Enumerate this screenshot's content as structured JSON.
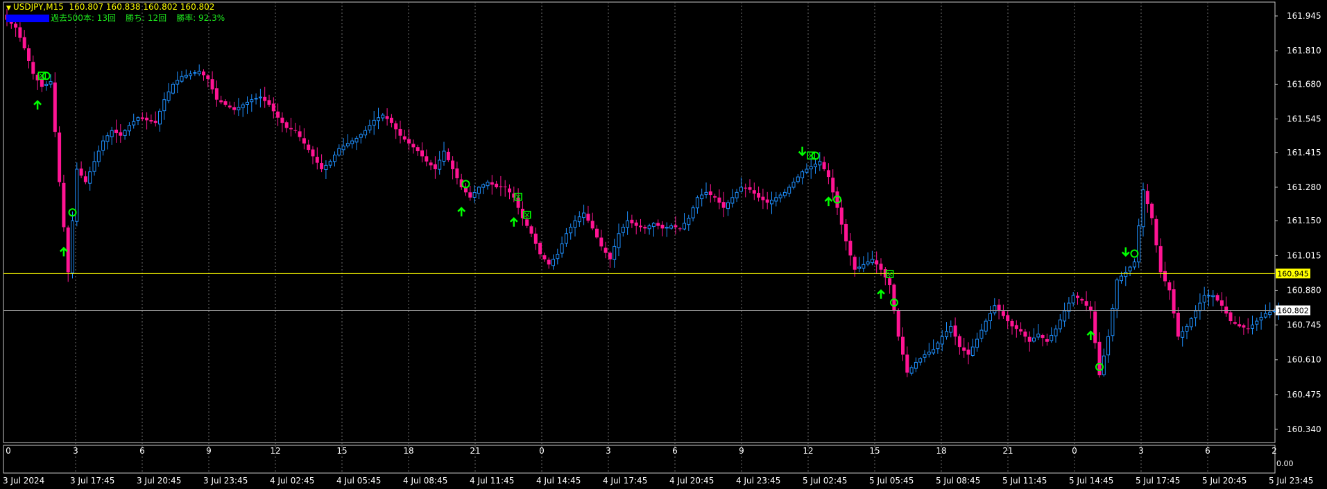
{
  "header": {
    "symbol": "USDJPY,M15",
    "ohlc": "160.807 160.838 160.802 160.802",
    "stats_past": "過去500本: 13回",
    "stats_wins": "勝ち: 12回",
    "stats_rate": "勝率: 92.3%"
  },
  "colors": {
    "background": "#000000",
    "bull": "#1e90ff",
    "bear": "#ff1493",
    "signal": "#00ff00",
    "level_line": "#ffff00",
    "bid_line": "#a0a0a0",
    "grid": "#6e6e6e"
  },
  "chart_data": {
    "type": "candlestick",
    "symbol": "USDJPY",
    "timeframe": "M15",
    "ylim": [
      160.28,
      162.0
    ],
    "y_ticks": [
      "161.945",
      "161.810",
      "161.680",
      "161.545",
      "161.415",
      "161.280",
      "161.150",
      "161.015",
      "160.880",
      "160.745",
      "160.610",
      "160.475",
      "160.340"
    ],
    "horizontal_lines": [
      {
        "label": "160.945",
        "value": 160.945,
        "color": "#ffff00"
      },
      {
        "label": "160.802",
        "value": 160.802,
        "color": "#a0a0a0"
      }
    ],
    "x_hour_labels": [
      "0",
      "3",
      "6",
      "9",
      "12",
      "15",
      "18",
      "21",
      "0",
      "3",
      "6",
      "9",
      "12",
      "15",
      "18",
      "21",
      "0",
      "3",
      "6",
      "2"
    ],
    "x_date_labels": [
      "3 Jul 2024",
      "3 Jul 17:45",
      "3 Jul 20:45",
      "3 Jul 23:45",
      "4 Jul 02:45",
      "4 Jul 05:45",
      "4 Jul 08:45",
      "4 Jul 11:45",
      "4 Jul 14:45",
      "4 Jul 17:45",
      "4 Jul 20:45",
      "4 Jul 23:45",
      "5 Jul 02:45",
      "5 Jul 05:45",
      "5 Jul 08:45",
      "5 Jul 11:45",
      "5 Jul 14:45",
      "5 Jul 17:45",
      "5 Jul 20:45",
      "5 Jul 23:45"
    ],
    "sub_panel_label": "0.00",
    "close_path": [
      [
        0,
        161.93
      ],
      [
        2,
        161.9
      ],
      [
        4,
        161.82
      ],
      [
        6,
        161.72
      ],
      [
        8,
        161.67
      ],
      [
        10,
        161.69
      ],
      [
        12,
        161.3
      ],
      [
        14,
        160.95
      ],
      [
        16,
        161.35
      ],
      [
        18,
        161.3
      ],
      [
        20,
        161.38
      ],
      [
        22,
        161.46
      ],
      [
        24,
        161.5
      ],
      [
        26,
        161.48
      ],
      [
        28,
        161.52
      ],
      [
        30,
        161.55
      ],
      [
        32,
        161.54
      ],
      [
        34,
        161.53
      ],
      [
        36,
        161.62
      ],
      [
        38,
        161.68
      ],
      [
        40,
        161.71
      ],
      [
        42,
        161.72
      ],
      [
        44,
        161.73
      ],
      [
        46,
        161.7
      ],
      [
        48,
        161.62
      ],
      [
        50,
        161.6
      ],
      [
        52,
        161.58
      ],
      [
        54,
        161.6
      ],
      [
        56,
        161.62
      ],
      [
        58,
        161.63
      ],
      [
        60,
        161.6
      ],
      [
        62,
        161.55
      ],
      [
        64,
        161.51
      ],
      [
        66,
        161.5
      ],
      [
        68,
        161.45
      ],
      [
        70,
        161.4
      ],
      [
        72,
        161.35
      ],
      [
        74,
        161.38
      ],
      [
        76,
        161.43
      ],
      [
        78,
        161.45
      ],
      [
        80,
        161.47
      ],
      [
        82,
        161.5
      ],
      [
        84,
        161.54
      ],
      [
        86,
        161.56
      ],
      [
        88,
        161.53
      ],
      [
        90,
        161.48
      ],
      [
        92,
        161.45
      ],
      [
        94,
        161.42
      ],
      [
        96,
        161.38
      ],
      [
        98,
        161.35
      ],
      [
        100,
        161.42
      ],
      [
        102,
        161.35
      ],
      [
        104,
        161.28
      ],
      [
        106,
        161.24
      ],
      [
        108,
        161.28
      ],
      [
        110,
        161.3
      ],
      [
        112,
        161.28
      ],
      [
        114,
        161.28
      ],
      [
        116,
        161.24
      ],
      [
        118,
        161.16
      ],
      [
        120,
        161.1
      ],
      [
        122,
        161.02
      ],
      [
        124,
        160.98
      ],
      [
        126,
        161.02
      ],
      [
        128,
        161.1
      ],
      [
        130,
        161.15
      ],
      [
        132,
        161.18
      ],
      [
        134,
        161.12
      ],
      [
        136,
        161.05
      ],
      [
        138,
        161.0
      ],
      [
        140,
        161.1
      ],
      [
        142,
        161.15
      ],
      [
        144,
        161.13
      ],
      [
        146,
        161.12
      ],
      [
        148,
        161.14
      ],
      [
        150,
        161.12
      ],
      [
        152,
        161.13
      ],
      [
        154,
        161.12
      ],
      [
        156,
        161.16
      ],
      [
        158,
        161.24
      ],
      [
        160,
        161.26
      ],
      [
        162,
        161.24
      ],
      [
        164,
        161.2
      ],
      [
        166,
        161.24
      ],
      [
        168,
        161.28
      ],
      [
        170,
        161.27
      ],
      [
        172,
        161.24
      ],
      [
        174,
        161.22
      ],
      [
        176,
        161.24
      ],
      [
        178,
        161.26
      ],
      [
        180,
        161.3
      ],
      [
        182,
        161.34
      ],
      [
        184,
        161.36
      ],
      [
        186,
        161.38
      ],
      [
        188,
        161.32
      ],
      [
        190,
        161.2
      ],
      [
        192,
        161.07
      ],
      [
        194,
        160.96
      ],
      [
        196,
        160.98
      ],
      [
        198,
        161.0
      ],
      [
        200,
        160.96
      ],
      [
        202,
        160.9
      ],
      [
        204,
        160.7
      ],
      [
        206,
        160.56
      ],
      [
        208,
        160.6
      ],
      [
        210,
        160.63
      ],
      [
        212,
        160.65
      ],
      [
        214,
        160.7
      ],
      [
        216,
        160.74
      ],
      [
        218,
        160.66
      ],
      [
        220,
        160.63
      ],
      [
        222,
        160.69
      ],
      [
        224,
        160.76
      ],
      [
        226,
        160.82
      ],
      [
        228,
        160.78
      ],
      [
        230,
        160.74
      ],
      [
        232,
        160.72
      ],
      [
        234,
        160.68
      ],
      [
        236,
        160.71
      ],
      [
        238,
        160.68
      ],
      [
        240,
        160.73
      ],
      [
        242,
        160.8
      ],
      [
        244,
        160.86
      ],
      [
        246,
        160.84
      ],
      [
        248,
        160.8
      ],
      [
        250,
        160.55
      ],
      [
        252,
        160.7
      ],
      [
        254,
        160.92
      ],
      [
        256,
        160.95
      ],
      [
        258,
        160.99
      ],
      [
        260,
        161.27
      ],
      [
        262,
        161.16
      ],
      [
        264,
        160.95
      ],
      [
        266,
        160.88
      ],
      [
        268,
        160.7
      ],
      [
        270,
        160.74
      ],
      [
        272,
        160.8
      ],
      [
        274,
        160.86
      ],
      [
        276,
        160.86
      ],
      [
        278,
        160.82
      ],
      [
        280,
        160.76
      ],
      [
        282,
        160.74
      ],
      [
        284,
        160.73
      ],
      [
        286,
        160.76
      ],
      [
        288,
        160.79
      ],
      [
        290,
        160.8
      ],
      [
        291,
        160.8
      ]
    ],
    "markers": [
      {
        "i": 7,
        "type": "arrow-up"
      },
      {
        "i": 8,
        "type": "box"
      },
      {
        "i": 9,
        "type": "circle"
      },
      {
        "i": 13,
        "type": "arrow-up"
      },
      {
        "i": 15,
        "type": "circle"
      },
      {
        "i": 104,
        "type": "arrow-up"
      },
      {
        "i": 105,
        "type": "circle"
      },
      {
        "i": 116,
        "type": "arrow-up"
      },
      {
        "i": 117,
        "type": "box"
      },
      {
        "i": 119,
        "type": "box"
      },
      {
        "i": 182,
        "type": "arrow-down"
      },
      {
        "i": 184,
        "type": "box"
      },
      {
        "i": 185,
        "type": "circle"
      },
      {
        "i": 188,
        "type": "arrow-up"
      },
      {
        "i": 190,
        "type": "circle"
      },
      {
        "i": 200,
        "type": "arrow-up"
      },
      {
        "i": 202,
        "type": "box"
      },
      {
        "i": 203,
        "type": "circle"
      },
      {
        "i": 248,
        "type": "arrow-up"
      },
      {
        "i": 250,
        "type": "circle"
      },
      {
        "i": 256,
        "type": "arrow-down"
      },
      {
        "i": 258,
        "type": "circle"
      }
    ]
  }
}
